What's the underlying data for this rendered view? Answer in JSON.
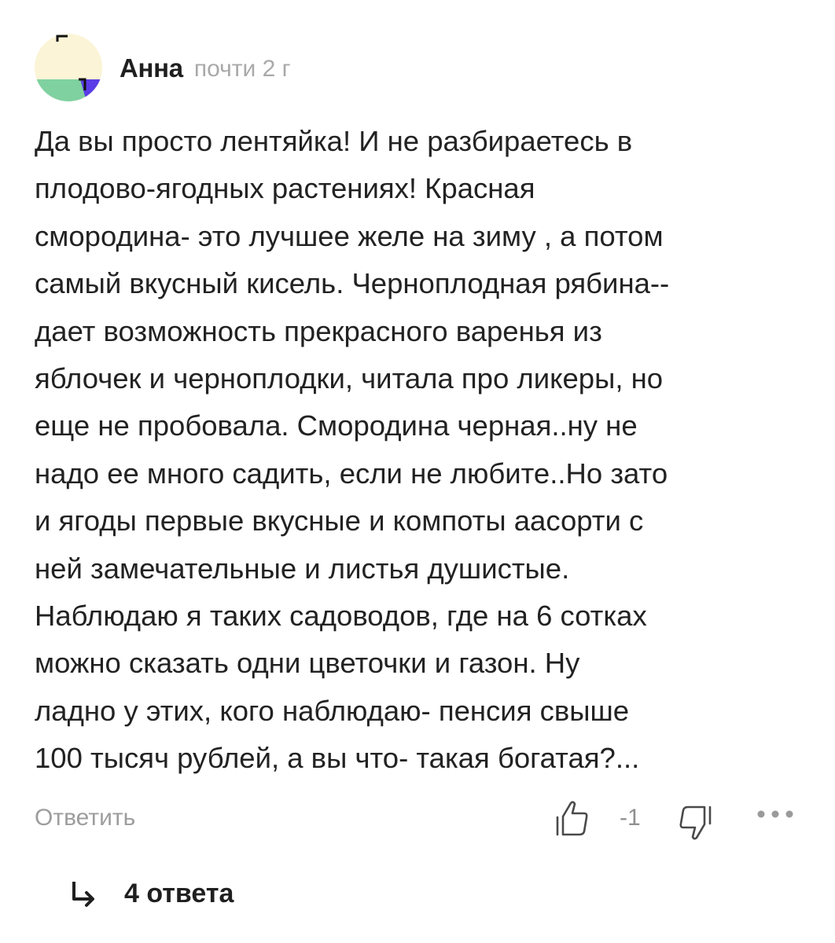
{
  "comment": {
    "author": "Анна",
    "time": "почти 2 г",
    "avatar_icon": "avatar-abstract-icon",
    "avatar_colors": [
      "#fbf4d6",
      "#7fd1a0",
      "#5a3de6",
      "#111111"
    ],
    "body_lines": [
      "Да вы просто лентяйка! И не разбираетесь в",
      "плодово-ягодных растениях! Красная",
      "смородина- это лучшее желе на зиму , а потом",
      "самый вкусный кисель. Черноплодная рябина--",
      "дает возможность прекрасного варенья из",
      "яблочек и черноплодки, читала про ликеры, но",
      "еще не пробовала. Смородина черная..ну не",
      "надо ее много садить, если не любите..Но зато",
      "и ягоды первые вкусные и компоты аасорти с",
      "ней замечательные и листья душистые.",
      "Наблюдаю я таких садоводов, где на 6 сотках",
      "можно сказать одни цветочки и газон. Ну",
      "ладно у этих, кого наблюдаю- пенсия свыше",
      "100 тысяч рублей, а вы что- такая богатая?..."
    ]
  },
  "actions": {
    "reply_label": "Ответить",
    "rating": "-1",
    "like_icon": "thumbs-up-icon",
    "dislike_icon": "thumbs-down-icon",
    "more_icon": "more-dots-icon"
  },
  "replies": {
    "arrow_icon": "reply-arrow-icon",
    "label": "4 ответа"
  }
}
